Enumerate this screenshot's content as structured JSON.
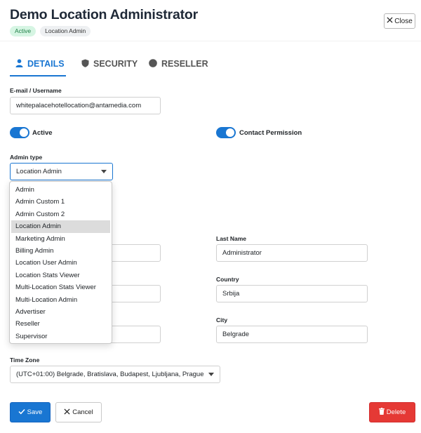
{
  "header": {
    "title": "Demo Location Administrator",
    "status_badge": "Active",
    "role_badge": "Location Admin",
    "close_label": "Close"
  },
  "tabs": [
    {
      "label": "DETAILS",
      "icon": "person-icon",
      "active": true
    },
    {
      "label": "SECURITY",
      "icon": "shield-icon",
      "active": false
    },
    {
      "label": "RESELLER",
      "icon": "circle-icon",
      "active": false
    }
  ],
  "form": {
    "email_label": "E-mail / Username",
    "email_value": "whitepalacehotellocation@antamedia.com",
    "active_toggle_label": "Active",
    "active_toggle_on": true,
    "contact_toggle_label": "Contact Permission",
    "contact_toggle_on": true,
    "admin_type_label": "Admin type",
    "admin_type_value": "Location Admin",
    "admin_type_options": [
      "Admin",
      "Admin Custom 1",
      "Admin Custom 2",
      "Location Admin",
      "Marketing Admin",
      "Billing Admin",
      "Location User Admin",
      "Location Stats Viewer",
      "Multi-Location Stats Viewer",
      "Multi-Location Admin",
      "Advertiser",
      "Reseller",
      "Supervisor"
    ],
    "last_name_label": "Last Name",
    "last_name_value": "Administrator",
    "country_label": "Country",
    "country_value": "Srbija",
    "city_label": "City",
    "city_value": "Belgrade",
    "timezone_label": "Time Zone",
    "timezone_value": "(UTC+01:00) Belgrade, Bratislava, Budapest, Ljubljana, Prague"
  },
  "actions": {
    "save_label": "Save",
    "cancel_label": "Cancel",
    "delete_label": "Delete"
  },
  "colors": {
    "primary": "#1976d2",
    "danger": "#e53935",
    "success_badge_bg": "#d6f5e3"
  }
}
